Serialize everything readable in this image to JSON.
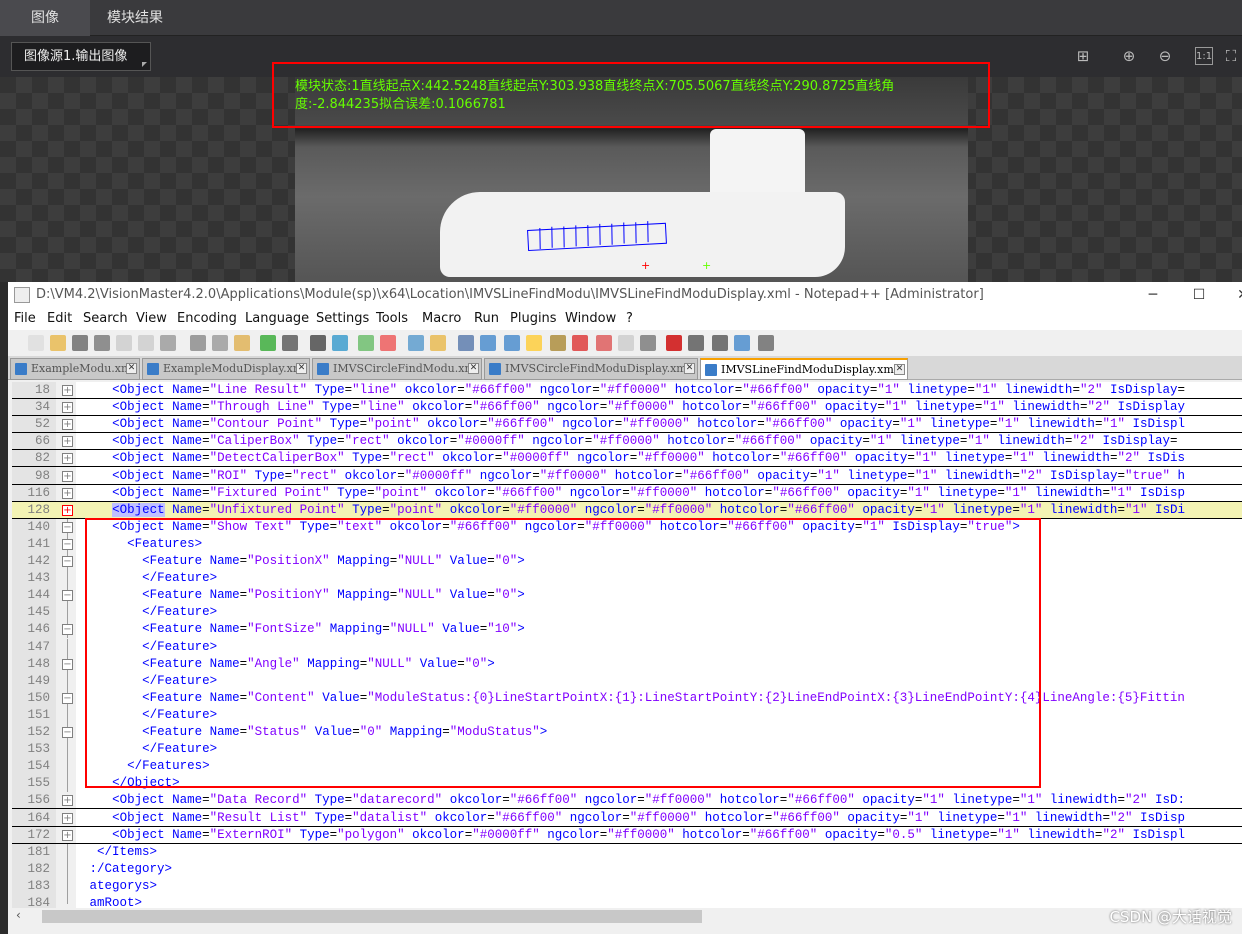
{
  "app": {
    "tabs": [
      {
        "label": "图像",
        "active": true
      },
      {
        "label": "模块结果",
        "active": false
      }
    ],
    "image_source": "图像源1.输出图像",
    "view_icons": [
      "fit-icon",
      "zoom-in-icon",
      "zoom-out-icon",
      "actual-size-icon",
      "fullscreen-icon"
    ],
    "overlay_line1": "模块状态:1直线起点X:442.5248直线起点Y:303.938直线终点X:705.5067直线终点Y:290.8725直线角",
    "overlay_line2": "度:-2.844235拟合误差:0.1066781",
    "overlay_color": "#66ff00"
  },
  "notepad": {
    "title": "D:\\VM4.2\\VisionMaster4.2.0\\Applications\\Module(sp)\\x64\\Location\\IMVSLineFindModu\\IMVSLineFindModuDisplay.xml - Notepad++ [Administrator]",
    "menu": [
      "File",
      "Edit",
      "Search",
      "View",
      "Encoding",
      "Language",
      "Settings",
      "Tools",
      "Macro",
      "Run",
      "Plugins",
      "Window",
      "?"
    ],
    "file_tabs": [
      {
        "label": "ExampleModu.xml",
        "active": false
      },
      {
        "label": "ExampleModuDisplay.xml",
        "active": false
      },
      {
        "label": "IMVSCircleFindModu.xml",
        "active": false
      },
      {
        "label": "IMVSCircleFindModuDisplay.xml",
        "active": false
      },
      {
        "label": "IMVSLineFindModuDisplay.xml",
        "active": true
      }
    ],
    "lines": [
      {
        "n": "18",
        "fold": "plus",
        "text": "    <Object Name=\"Line Result\" Type=\"line\" okcolor=\"#66ff00\" ngcolor=\"#ff0000\" hotcolor=\"#66ff00\" opacity=\"1\" linetype=\"1\" linewidth=\"2\" IsDisplay="
      },
      {
        "n": "34",
        "fold": "plus",
        "text": "    <Object Name=\"Through Line\" Type=\"line\" okcolor=\"#66ff00\" ngcolor=\"#ff0000\" hotcolor=\"#66ff00\" opacity=\"1\" linetype=\"1\" linewidth=\"2\" IsDisplay"
      },
      {
        "n": "52",
        "fold": "plus",
        "text": "    <Object Name=\"Contour Point\" Type=\"point\" okcolor=\"#66ff00\" ngcolor=\"#ff0000\" hotcolor=\"#66ff00\" opacity=\"1\" linetype=\"1\" linewidth=\"1\" IsDispl"
      },
      {
        "n": "66",
        "fold": "plus",
        "text": "    <Object Name=\"CaliperBox\" Type=\"rect\" okcolor=\"#0000ff\" ngcolor=\"#ff0000\" hotcolor=\"#66ff00\" opacity=\"1\" linetype=\"1\" linewidth=\"2\" IsDisplay="
      },
      {
        "n": "82",
        "fold": "plus",
        "text": "    <Object Name=\"DetectCaliperBox\" Type=\"rect\" okcolor=\"#0000ff\" ngcolor=\"#ff0000\" hotcolor=\"#66ff00\" opacity=\"1\" linetype=\"1\" linewidth=\"2\" IsDis"
      },
      {
        "n": "98",
        "fold": "plus",
        "text": "    <Object Name=\"ROI\" Type=\"rect\" okcolor=\"#0000ff\" ngcolor=\"#ff0000\" hotcolor=\"#66ff00\" opacity=\"1\" linetype=\"1\" linewidth=\"2\" IsDisplay=\"true\" h"
      },
      {
        "n": "116",
        "fold": "plus",
        "text": "    <Object Name=\"Fixtured Point\" Type=\"point\" okcolor=\"#66ff00\" ngcolor=\"#ff0000\" hotcolor=\"#66ff00\" opacity=\"1\" linetype=\"1\" linewidth=\"1\" IsDisp"
      },
      {
        "n": "128",
        "fold": "plus-red",
        "highlight": true,
        "text": "    <Object Name=\"Unfixtured Point\" Type=\"point\" okcolor=\"#ff0000\" ngcolor=\"#ff0000\" hotcolor=\"#66ff00\" opacity=\"1\" linetype=\"1\" linewidth=\"1\" IsDi"
      },
      {
        "n": "140",
        "fold": "minus",
        "text": "    <Object Name=\"Show Text\" Type=\"text\" okcolor=\"#66ff00\" ngcolor=\"#ff0000\" hotcolor=\"#66ff00\" opacity=\"1\" IsDisplay=\"true\">"
      },
      {
        "n": "141",
        "fold": "minus",
        "text": "      <Features>"
      },
      {
        "n": "142",
        "fold": "minus",
        "text": "        <Feature Name=\"PositionX\" Mapping=\"NULL\" Value=\"0\">"
      },
      {
        "n": "143",
        "fold": "line",
        "text": "        </Feature>"
      },
      {
        "n": "144",
        "fold": "minus",
        "text": "        <Feature Name=\"PositionY\" Mapping=\"NULL\" Value=\"0\">"
      },
      {
        "n": "145",
        "fold": "line",
        "text": "        </Feature>"
      },
      {
        "n": "146",
        "fold": "minus",
        "text": "        <Feature Name=\"FontSize\" Mapping=\"NULL\" Value=\"10\">"
      },
      {
        "n": "147",
        "fold": "line",
        "text": "        </Feature>"
      },
      {
        "n": "148",
        "fold": "minus",
        "text": "        <Feature Name=\"Angle\" Mapping=\"NULL\" Value=\"0\">"
      },
      {
        "n": "149",
        "fold": "line",
        "text": "        </Feature>"
      },
      {
        "n": "150",
        "fold": "minus",
        "text": "        <Feature Name=\"Content\" Value=\"ModuleStatus:{0}LineStartPointX:{1}:LineStartPointY:{2}LineEndPointX:{3}LineEndPointY:{4}LineAngle:{5}Fittin"
      },
      {
        "n": "151",
        "fold": "line",
        "text": "        </Feature>"
      },
      {
        "n": "152",
        "fold": "minus",
        "text": "        <Feature Name=\"Status\" Value=\"0\" Mapping=\"ModuStatus\">"
      },
      {
        "n": "153",
        "fold": "line",
        "text": "        </Feature>"
      },
      {
        "n": "154",
        "fold": "line",
        "text": "      </Features>"
      },
      {
        "n": "155",
        "fold": "line",
        "text": "    </Object>"
      },
      {
        "n": "156",
        "fold": "plus",
        "text": "    <Object Name=\"Data Record\" Type=\"datarecord\" okcolor=\"#66ff00\" ngcolor=\"#ff0000\" hotcolor=\"#66ff00\" opacity=\"1\" linetype=\"1\" linewidth=\"2\" IsD:"
      },
      {
        "n": "164",
        "fold": "plus",
        "text": "    <Object Name=\"Result List\" Type=\"datalist\" okcolor=\"#66ff00\" ngcolor=\"#ff0000\" hotcolor=\"#66ff00\" opacity=\"1\" linetype=\"1\" linewidth=\"2\" IsDisp"
      },
      {
        "n": "172",
        "fold": "plus",
        "text": "    <Object Name=\"ExternROI\" Type=\"polygon\" okcolor=\"#0000ff\" ngcolor=\"#ff0000\" hotcolor=\"#66ff00\" opacity=\"0.5\" linetype=\"1\" linewidth=\"2\" IsDispl"
      },
      {
        "n": "181",
        "fold": "line",
        "text": "  </Items>"
      },
      {
        "n": "182",
        "fold": "line",
        "text": " :/Category>"
      },
      {
        "n": "183",
        "fold": "line",
        "text": " ategorys>"
      },
      {
        "n": "184",
        "fold": "end",
        "text": " amRoot>"
      }
    ]
  },
  "watermark": "CSDN @大话视觉"
}
